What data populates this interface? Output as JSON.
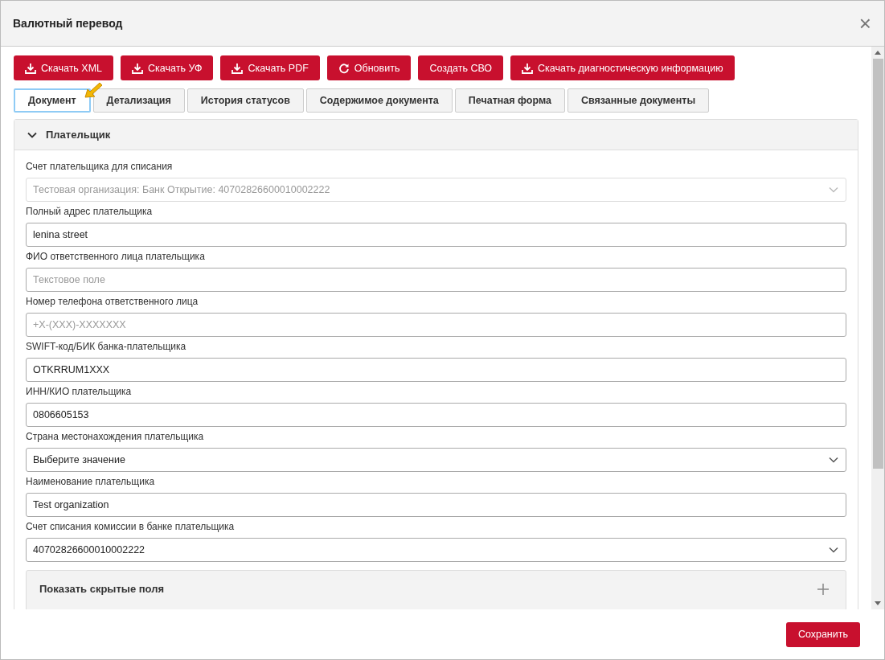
{
  "window": {
    "title": "Валютный перевод",
    "close": "×"
  },
  "toolbar": [
    {
      "label": "Скачать XML",
      "kind": "download"
    },
    {
      "label": "Скачать УФ",
      "kind": "download"
    },
    {
      "label": "Скачать PDF",
      "kind": "download"
    },
    {
      "label": "Обновить",
      "kind": "refresh"
    },
    {
      "label": "Создать СВО",
      "kind": "plain"
    },
    {
      "label": "Скачать диагностическую информацию",
      "kind": "download"
    }
  ],
  "tabs": [
    {
      "label": "Документ",
      "selected": true
    },
    {
      "label": "Детализация",
      "selected": false
    },
    {
      "label": "История статусов",
      "selected": false
    },
    {
      "label": "Содержимое документа",
      "selected": false
    },
    {
      "label": "Печатная форма",
      "selected": false
    },
    {
      "label": "Связанные документы",
      "selected": false
    }
  ],
  "section": {
    "title": "Плательщик",
    "expanded": true,
    "fields": [
      {
        "label": "Счет плательщика для списания",
        "kind": "select",
        "value": "Тестовая организация: Банк Открытие: 40702826600010002222",
        "disabled": true
      },
      {
        "label": "Полный адрес плательщика",
        "kind": "text",
        "value": "lenina street",
        "disabled": false
      },
      {
        "label": "ФИО ответственного лица плательщика",
        "kind": "text",
        "placeholder": "Текстовое поле",
        "disabled": false
      },
      {
        "label": "Номер телефона ответственного лица",
        "kind": "text",
        "placeholder": "+X-(XXX)-XXXXXXX",
        "disabled": false
      },
      {
        "label": "SWIFT-код/БИК банка-плательщика",
        "kind": "text",
        "value": "OTKRRUM1XXX",
        "disabled": false
      },
      {
        "label": "ИНН/КИО плательщика",
        "kind": "text",
        "value": "0806605153",
        "disabled": false
      },
      {
        "label": "Страна местонахождения плательщика",
        "kind": "select",
        "value": "Выберите значение",
        "disabled": false
      },
      {
        "label": "Наименование плательщика",
        "kind": "text",
        "value": "Test organization",
        "disabled": false
      },
      {
        "label": "Счет списания комиссии в банке плательщика",
        "kind": "select",
        "value": "40702826600010002222",
        "disabled": false
      }
    ]
  },
  "hidden_fields": {
    "title": "Показать скрытые поля",
    "expanded": false
  },
  "footer": {
    "save": "Сохранить"
  }
}
